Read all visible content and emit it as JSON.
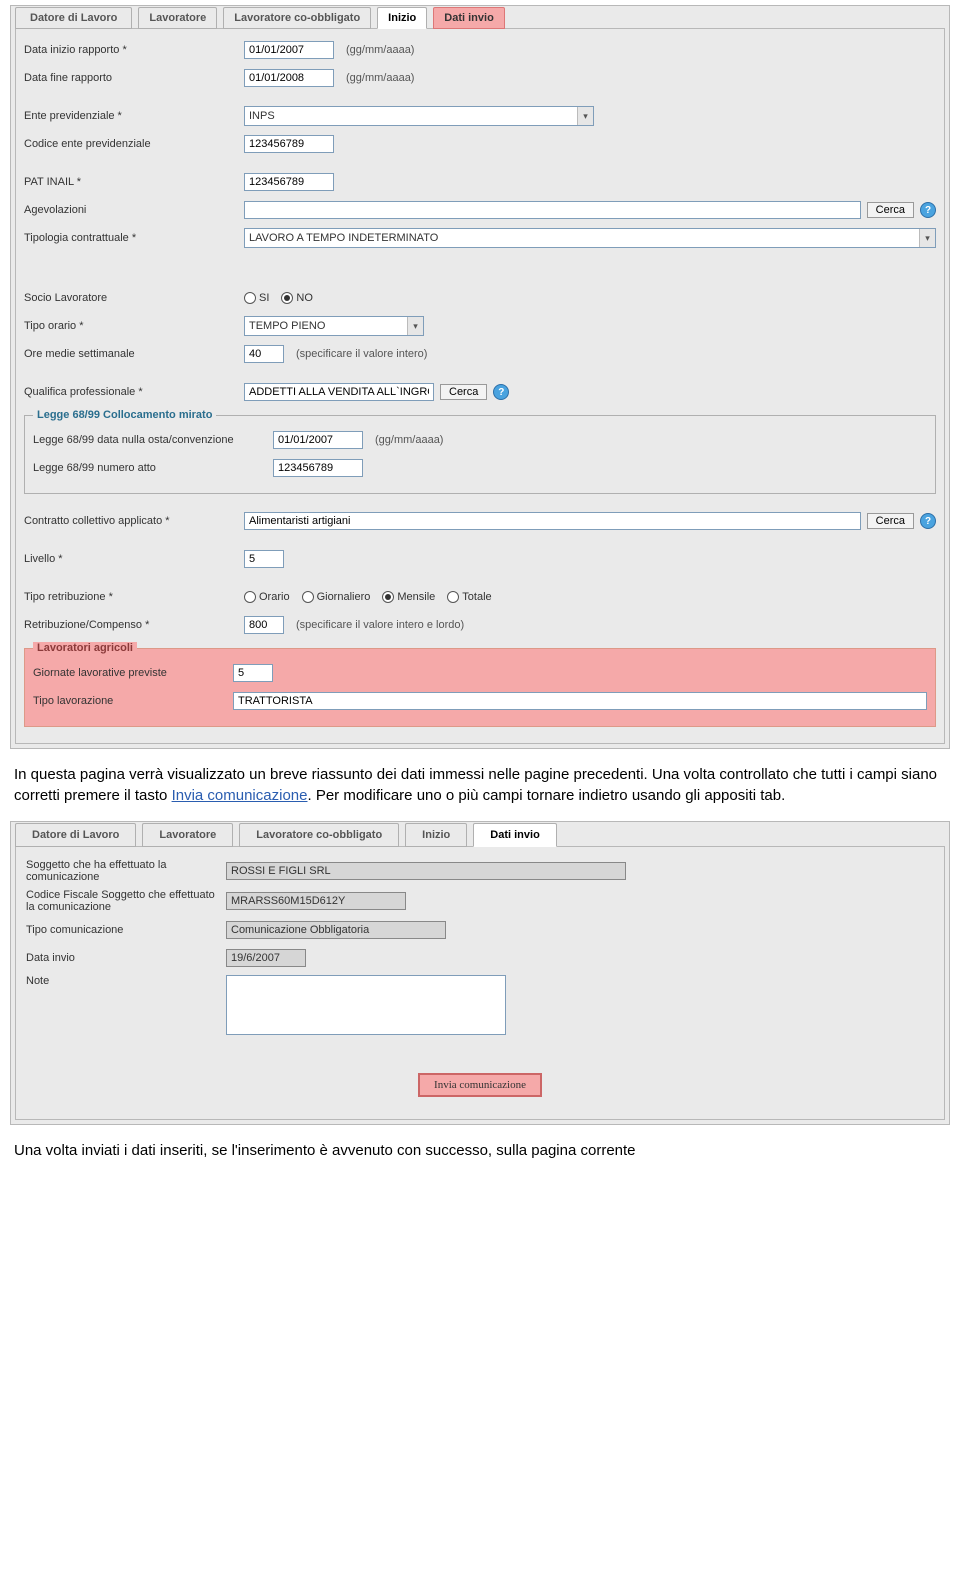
{
  "tabs1": {
    "t0": "Datore di Lavoro",
    "t1": "Lavoratore",
    "t2": "Lavoratore co-obbligato",
    "t3": "Inizio",
    "t4": "Dati invio"
  },
  "form1": {
    "data_inizio_lbl": "Data inizio rapporto *",
    "data_inizio_val": "01/01/2007",
    "data_fine_lbl": "Data fine rapporto",
    "data_fine_val": "01/01/2008",
    "date_hint": "(gg/mm/aaaa)",
    "ente_prev_lbl": "Ente previdenziale *",
    "ente_prev_val": "INPS",
    "cod_ente_lbl": "Codice ente previdenziale",
    "cod_ente_val": "123456789",
    "pat_inail_lbl": "PAT INAIL *",
    "pat_inail_val": "123456789",
    "agevolazioni_lbl": "Agevolazioni",
    "agevolazioni_val": "",
    "cerca": "Cerca",
    "tipologia_lbl": "Tipologia contrattuale *",
    "tipologia_val": "LAVORO A TEMPO INDETERMINATO",
    "socio_lbl": "Socio Lavoratore",
    "socio_si": "SI",
    "socio_no": "NO",
    "tipo_orario_lbl": "Tipo orario *",
    "tipo_orario_val": "TEMPO PIENO",
    "ore_lbl": "Ore medie settimanale",
    "ore_val": "40",
    "ore_hint": "(specificare il valore intero)",
    "qualifica_lbl": "Qualifica professionale *",
    "qualifica_val": "ADDETTI ALLA VENDITA ALL`INGRO",
    "legge_title": "Legge 68/99 Collocamento mirato",
    "legge_data_lbl": "Legge 68/99 data nulla osta/convenzione",
    "legge_data_val": "01/01/2007",
    "legge_num_lbl": "Legge 68/99 numero atto",
    "legge_num_val": "123456789",
    "ccnl_lbl": "Contratto collettivo applicato *",
    "ccnl_val": "Alimentaristi artigiani",
    "livello_lbl": "Livello *",
    "livello_val": "5",
    "tipo_retr_lbl": "Tipo retribuzione *",
    "retr_orario": "Orario",
    "retr_giorn": "Giornaliero",
    "retr_mensile": "Mensile",
    "retr_totale": "Totale",
    "retr_lbl": "Retribuzione/Compenso *",
    "retr_val": "800",
    "retr_hint": "(specificare il valore intero e lordo)",
    "agri_title": "Lavoratori agricoli",
    "agri_giorn_lbl": "Giornate lavorative previste",
    "agri_giorn_val": "5",
    "agri_tipo_lbl": "Tipo lavorazione",
    "agri_tipo_val": "TRATTORISTA"
  },
  "paragraph": {
    "p1": "In questa pagina verrà visualizzato un breve riassunto dei dati immessi nelle pagine precedenti. Una volta controllato che tutti i campi siano corretti premere il tasto ",
    "link": "Invia comunicazione",
    "p2": ". Per modificare uno o più campi tornare indietro usando gli appositi tab."
  },
  "tabs2": {
    "t0": "Datore di Lavoro",
    "t1": "Lavoratore",
    "t2": "Lavoratore co-obbligato",
    "t3": "Inizio",
    "t4": "Dati invio"
  },
  "form2": {
    "sogg_lbl": "Soggetto che ha effettuato la comunicazione",
    "sogg_val": "ROSSI E FIGLI SRL",
    "cf_lbl": "Codice Fiscale Soggetto che effettuato la comunicazione",
    "cf_val": "MRARSS60M15D612Y",
    "tipo_com_lbl": "Tipo comunicazione",
    "tipo_com_val": "Comunicazione Obbligatoria",
    "data_invio_lbl": "Data invio",
    "data_invio_val": "19/6/2007",
    "note_lbl": "Note",
    "invia_btn": "Invia comunicazione"
  },
  "footer_text": "Una volta inviati i dati inseriti, se l'inserimento è avvenuto con successo, sulla pagina corrente"
}
